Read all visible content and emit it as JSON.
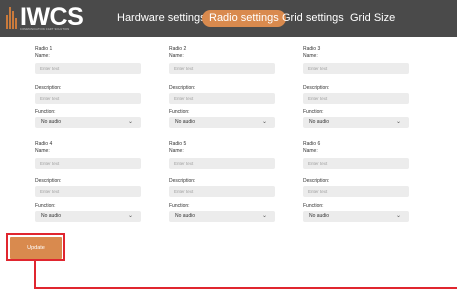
{
  "header": {
    "logo_text": "IWCS",
    "logo_subtitle": "COMMUNICATION CART SOLUTION",
    "nav": [
      {
        "label": "Hardware settings",
        "active": false
      },
      {
        "label": "Radio settings",
        "active": true
      },
      {
        "label": "Grid settings",
        "active": false
      },
      {
        "label": "Grid Size",
        "active": false
      }
    ]
  },
  "labels": {
    "name": "Name:",
    "description": "Description:",
    "function": "Function:",
    "placeholder": "Enter text"
  },
  "radios": [
    {
      "title": "Radio 1",
      "function": "No audio"
    },
    {
      "title": "Radio 2",
      "function": "No audio"
    },
    {
      "title": "Radio 3",
      "function": "No audio"
    },
    {
      "title": "Radio 4",
      "function": "No audio"
    },
    {
      "title": "Radio 5",
      "function": "No audio"
    },
    {
      "title": "Radio 6",
      "function": "No audio"
    }
  ],
  "update_label": "Update",
  "colors": {
    "accent": "#d98a4e",
    "header_bg": "#4a4a4a",
    "highlight": "#e0262f",
    "input_bg": "#ececec"
  }
}
